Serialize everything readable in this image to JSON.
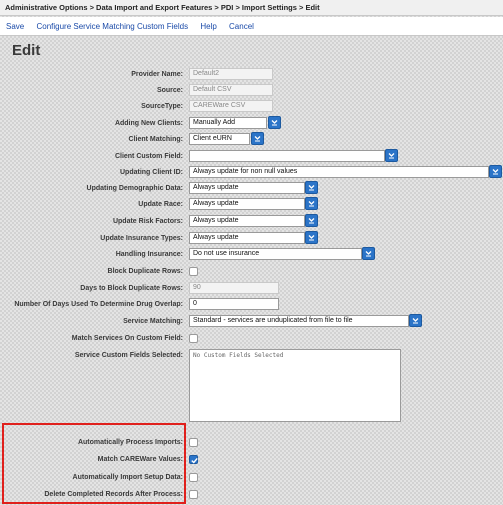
{
  "breadcrumb": "Administrative Options > Data Import and Export Features > PDI > Import Settings > Edit",
  "menu": {
    "save": "Save",
    "configure": "Configure Service Matching Custom Fields",
    "help": "Help",
    "cancel": "Cancel"
  },
  "title": "Edit",
  "fields": {
    "provider_name": {
      "label": "Provider Name:",
      "value": "Default2"
    },
    "source": {
      "label": "Source:",
      "value": "Default CSV"
    },
    "source_type": {
      "label": "SourceType:",
      "value": "CAREWare CSV"
    },
    "adding_new_clients": {
      "label": "Adding New Clients:",
      "value": "Manually Add"
    },
    "client_matching": {
      "label": "Client Matching:",
      "value": "Client eURN"
    },
    "client_custom_field": {
      "label": "Client Custom Field:",
      "value": ""
    },
    "updating_client_id": {
      "label": "Updating Client ID:",
      "value": "Always update for non null values"
    },
    "updating_demographic": {
      "label": "Updating Demographic Data:",
      "value": "Always update"
    },
    "update_race": {
      "label": "Update Race:",
      "value": "Always update"
    },
    "update_risk": {
      "label": "Update Risk Factors:",
      "value": "Always update"
    },
    "update_insurance": {
      "label": "Update Insurance Types:",
      "value": "Always update"
    },
    "handling_insurance": {
      "label": "Handling Insurance:",
      "value": "Do not use insurance"
    },
    "block_duplicate": {
      "label": "Block Duplicate Rows:",
      "checked": false
    },
    "days_block": {
      "label": "Days to Block Duplicate Rows:",
      "value": "90"
    },
    "drug_overlap": {
      "label": "Number Of Days Used To Determine Drug Overlap:",
      "value": "0"
    },
    "service_matching": {
      "label": "Service Matching:",
      "value": "Standard - services are unduplicated from file to file"
    },
    "match_custom": {
      "label": "Match Services On Custom Field:",
      "checked": false
    },
    "service_custom_selected": {
      "label": "Service Custom Fields Selected:",
      "value": "No Custom Fields Selected"
    },
    "auto_process": {
      "label": "Automatically Process Imports:",
      "checked": false
    },
    "match_careware": {
      "label": "Match CAREWare Values:",
      "checked": true
    },
    "auto_import_setup": {
      "label": "Automatically Import Setup Data:",
      "checked": false
    },
    "delete_completed": {
      "label": "Delete Completed Records After Process:",
      "checked": false
    }
  },
  "colors": {
    "accent": "#2b74c8",
    "highlight_border": "#e0201c",
    "link": "#1a4aa8"
  }
}
